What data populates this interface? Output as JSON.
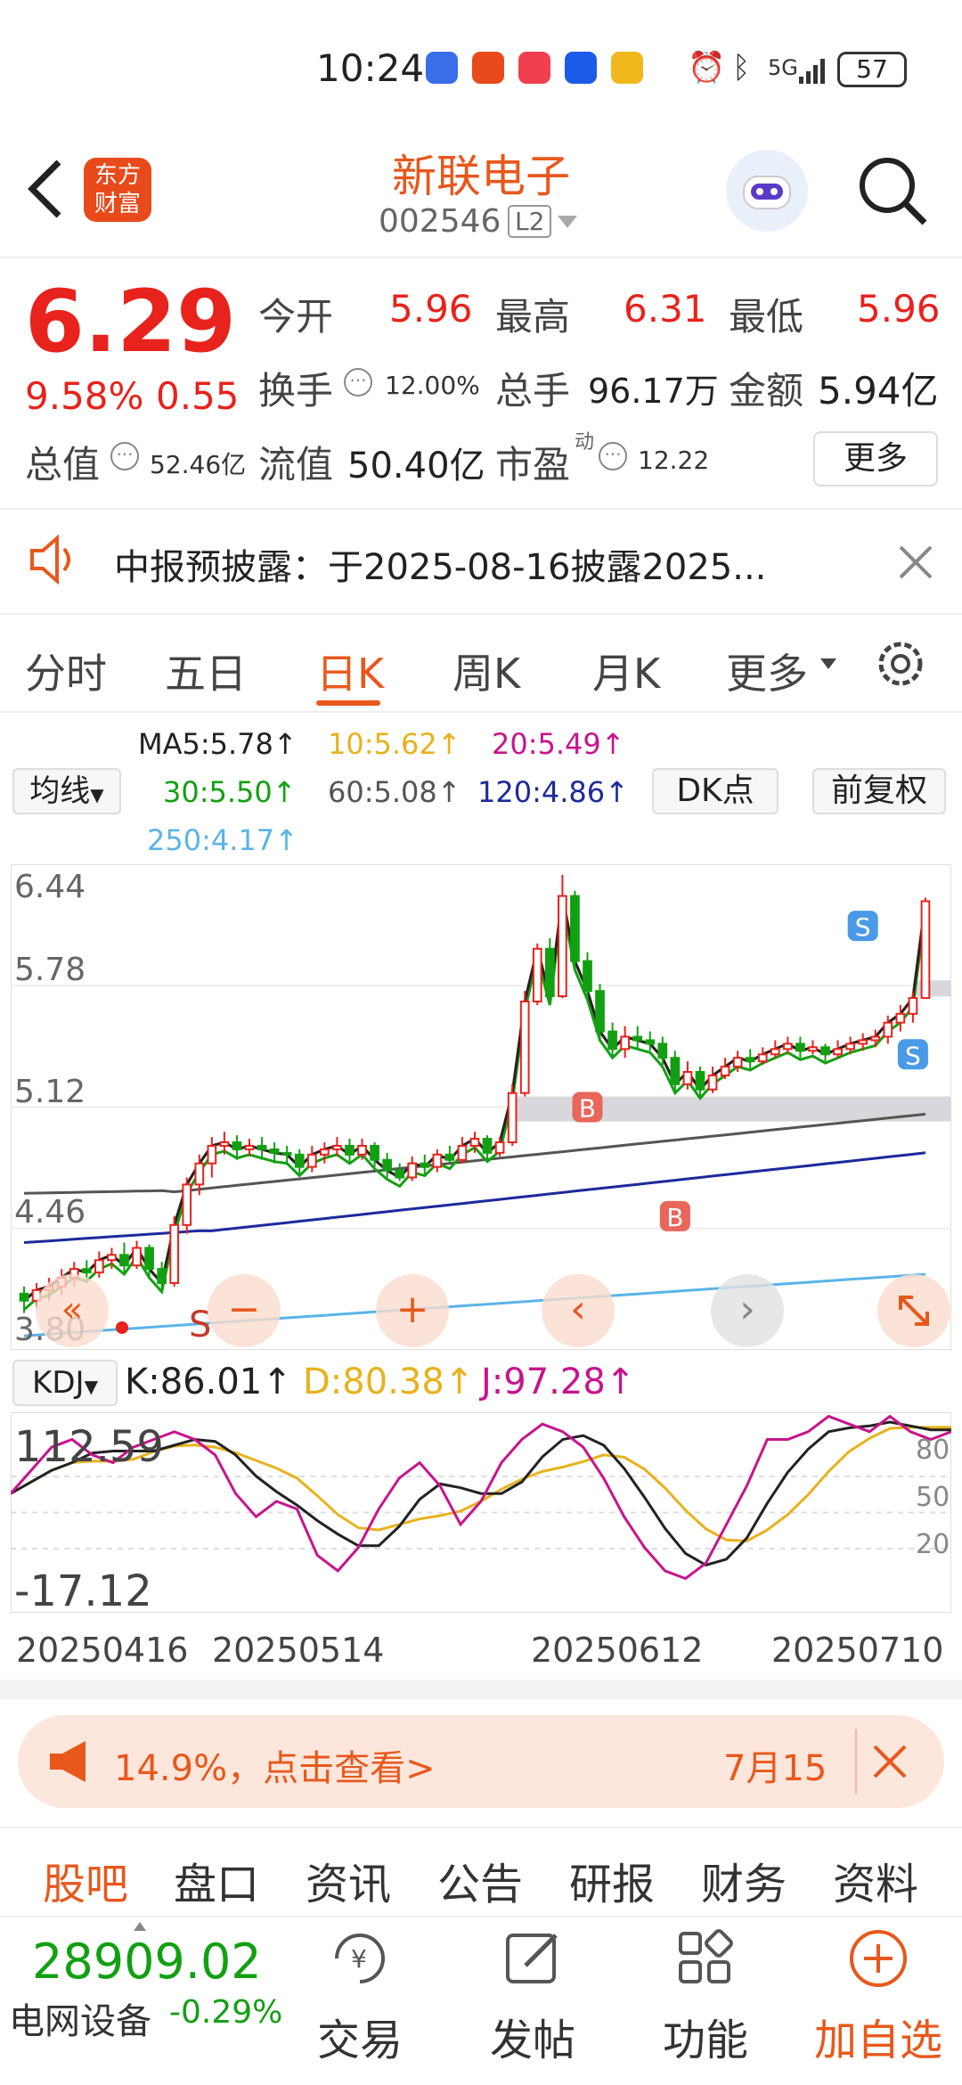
{
  "status": {
    "time": "10:24",
    "battery": "57",
    "signal": "5G"
  },
  "header": {
    "stock_name": "新联电子",
    "code": "002546",
    "level": "L2",
    "logo_line1": "东方",
    "logo_line2": "财富"
  },
  "quote": {
    "price": "6.29",
    "change_pct": "9.58%",
    "change": "0.55",
    "open_label": "今开",
    "open": "5.96",
    "high_label": "最高",
    "high": "6.31",
    "low_label": "最低",
    "low": "5.96",
    "turnover_label": "换手",
    "turnover": "12.00%",
    "volume_label": "总手",
    "volume": "96.17万",
    "amount_label": "金额",
    "amount": "5.94亿",
    "mktcap_label": "总值",
    "mktcap": "52.46亿",
    "float_label": "流值",
    "float": "50.40亿",
    "pe_label": "市盈",
    "pe_sup": "动",
    "pe": "12.22",
    "more": "更多"
  },
  "notice": {
    "text": "中报预披露：于2025-08-16披露2025..."
  },
  "tabs": [
    "分时",
    "五日",
    "日K",
    "周K",
    "月K",
    "更多"
  ],
  "active_tab": "日K",
  "ma": {
    "ma5": "MA5:5.78↑",
    "ma10": "10:5.62↑",
    "ma20": "20:5.49↑",
    "ma30": "30:5.50↑",
    "ma60": "60:5.08↑",
    "ma120": "120:4.86↑",
    "ma250": "250:4.17↑",
    "select": "均线",
    "dk": "DK点",
    "fq": "前复权"
  },
  "colors": {
    "ma5": "#222222",
    "ma10": "#e8b21c",
    "ma20": "#c8148c",
    "ma30": "#12a012",
    "ma60": "#555555",
    "ma120": "#1c2a9c",
    "ma250": "#5ab4e8",
    "up": "#e8221c",
    "down": "#12a012",
    "accent": "#e8581c"
  },
  "chart_data": {
    "type": "candlestick",
    "y_ticks": [
      "6.44",
      "5.78",
      "5.12",
      "4.46",
      "3.80"
    ],
    "x_ticks": [
      "20250416",
      "20250514",
      "20250612",
      "20250710"
    ],
    "candles": [
      [
        4.06,
        4.02,
        4.1,
        3.95
      ],
      [
        4.02,
        4.08,
        4.12,
        3.98
      ],
      [
        4.08,
        4.1,
        4.15,
        4.02
      ],
      [
        4.1,
        4.15,
        4.2,
        4.05
      ],
      [
        4.15,
        4.2,
        4.24,
        4.1
      ],
      [
        4.2,
        4.18,
        4.25,
        4.12
      ],
      [
        4.18,
        4.25,
        4.3,
        4.15
      ],
      [
        4.25,
        4.28,
        4.32,
        4.2
      ],
      [
        4.28,
        4.22,
        4.35,
        4.18
      ],
      [
        4.22,
        4.32,
        4.36,
        4.2
      ],
      [
        4.32,
        4.2,
        4.34,
        4.15
      ],
      [
        4.2,
        4.12,
        4.24,
        4.08
      ],
      [
        4.12,
        4.45,
        4.5,
        4.1
      ],
      [
        4.45,
        4.68,
        4.72,
        4.4
      ],
      [
        4.68,
        4.8,
        4.85,
        4.62
      ],
      [
        4.8,
        4.9,
        4.95,
        4.72
      ],
      [
        4.9,
        4.92,
        4.98,
        4.85
      ],
      [
        4.92,
        4.88,
        4.96,
        4.82
      ],
      [
        4.88,
        4.9,
        4.94,
        4.84
      ],
      [
        4.9,
        4.88,
        4.95,
        4.82
      ],
      [
        4.88,
        4.86,
        4.92,
        4.8
      ],
      [
        4.86,
        4.85,
        4.9,
        4.8
      ],
      [
        4.85,
        4.78,
        4.88,
        4.74
      ],
      [
        4.78,
        4.85,
        4.9,
        4.75
      ],
      [
        4.85,
        4.88,
        4.92,
        4.8
      ],
      [
        4.88,
        4.9,
        4.95,
        4.84
      ],
      [
        4.9,
        4.85,
        4.94,
        4.8
      ],
      [
        4.85,
        4.9,
        4.94,
        4.82
      ],
      [
        4.9,
        4.82,
        4.92,
        4.78
      ],
      [
        4.82,
        4.76,
        4.86,
        4.72
      ],
      [
        4.76,
        4.72,
        4.8,
        4.7
      ],
      [
        4.72,
        4.8,
        4.84,
        4.7
      ],
      [
        4.8,
        4.78,
        4.85,
        4.74
      ],
      [
        4.78,
        4.85,
        4.88,
        4.75
      ],
      [
        4.85,
        4.82,
        4.9,
        4.8
      ],
      [
        4.82,
        4.9,
        4.95,
        4.8
      ],
      [
        4.9,
        4.94,
        4.98,
        4.86
      ],
      [
        4.94,
        4.86,
        4.96,
        4.82
      ],
      [
        4.86,
        4.92,
        4.95,
        4.84
      ],
      [
        4.92,
        5.2,
        5.25,
        4.9
      ],
      [
        5.2,
        5.72,
        5.78,
        5.18
      ],
      [
        5.72,
        6.02,
        6.05,
        5.7
      ],
      [
        6.02,
        5.75,
        6.08,
        5.7
      ],
      [
        5.75,
        6.32,
        6.44,
        5.74
      ],
      [
        6.32,
        5.95,
        6.35,
        5.9
      ],
      [
        5.95,
        5.78,
        6.0,
        5.72
      ],
      [
        5.78,
        5.55,
        5.82,
        5.5
      ],
      [
        5.55,
        5.45,
        5.6,
        5.4
      ],
      [
        5.45,
        5.52,
        5.58,
        5.4
      ],
      [
        5.52,
        5.5,
        5.58,
        5.45
      ],
      [
        5.5,
        5.48,
        5.55,
        5.44
      ],
      [
        5.48,
        5.4,
        5.52,
        5.36
      ],
      [
        5.4,
        5.25,
        5.44,
        5.2
      ],
      [
        5.25,
        5.32,
        5.38,
        5.22
      ],
      [
        5.32,
        5.22,
        5.35,
        5.18
      ],
      [
        5.22,
        5.3,
        5.35,
        5.2
      ],
      [
        5.3,
        5.35,
        5.4,
        5.28
      ],
      [
        5.35,
        5.4,
        5.44,
        5.32
      ],
      [
        5.4,
        5.38,
        5.45,
        5.34
      ],
      [
        5.38,
        5.42,
        5.46,
        5.36
      ],
      [
        5.42,
        5.45,
        5.5,
        5.4
      ],
      [
        5.45,
        5.48,
        5.52,
        5.42
      ],
      [
        5.48,
        5.44,
        5.52,
        5.4
      ],
      [
        5.44,
        5.46,
        5.5,
        5.42
      ],
      [
        5.46,
        5.42,
        5.48,
        5.38
      ],
      [
        5.42,
        5.45,
        5.5,
        5.4
      ],
      [
        5.45,
        5.48,
        5.52,
        5.42
      ],
      [
        5.48,
        5.5,
        5.54,
        5.44
      ],
      [
        5.5,
        5.52,
        5.56,
        5.46
      ],
      [
        5.52,
        5.6,
        5.64,
        5.48
      ],
      [
        5.6,
        5.65,
        5.7,
        5.55
      ],
      [
        5.65,
        5.74,
        5.78,
        5.6
      ],
      [
        5.74,
        6.29,
        6.31,
        5.96
      ]
    ],
    "kdj": {
      "K": "K:86.01↑",
      "D": "D:80.38↑",
      "J": "J:97.28↑",
      "top": "112.59",
      "bottom": "-17.12",
      "levels": [
        "80",
        "50",
        "20"
      ]
    }
  },
  "ad": {
    "text": "14.9%，点击查看>",
    "date": "7月15"
  },
  "bottom_tabs": [
    "股吧",
    "盘口",
    "资讯",
    "公告",
    "研报",
    "财务",
    "资料"
  ],
  "dock": {
    "index_value": "28909.02",
    "index_name": "电网设备",
    "index_change": "-0.29%",
    "items": [
      "交易",
      "发帖",
      "功能",
      "加自选"
    ]
  }
}
